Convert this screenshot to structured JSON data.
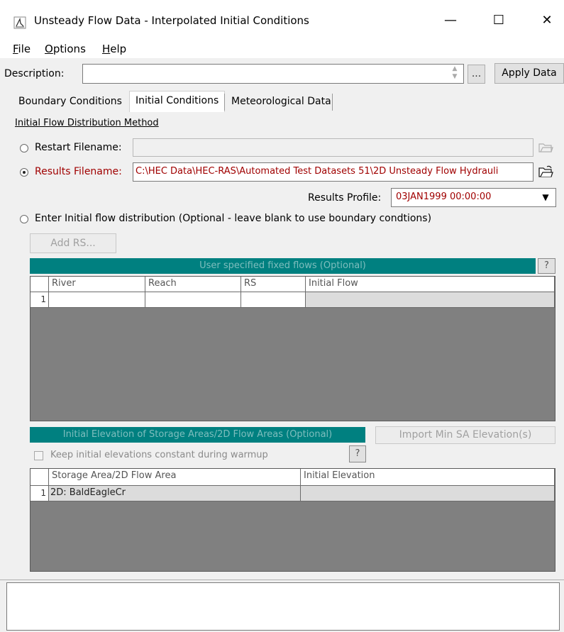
{
  "window": {
    "title": "Unsteady Flow Data - Interpolated Initial Conditions",
    "minimize": "—",
    "maximize": "☐",
    "close": "✕"
  },
  "menu": {
    "file": "File",
    "options": "Options",
    "help": "Help"
  },
  "description": {
    "label": "Description:",
    "value": "",
    "browse": "...",
    "apply": "Apply Data"
  },
  "tabs": [
    {
      "label": "Boundary Conditions",
      "active": false
    },
    {
      "label": "Initial Conditions",
      "active": true
    },
    {
      "label": "Meteorological Data",
      "active": false
    }
  ],
  "section_title": "Initial Flow Distribution Method",
  "restart": {
    "label": "Restart Filename:",
    "value": "",
    "selected": false
  },
  "results": {
    "label": "Results Filename:",
    "value": "C:\\HEC Data\\HEC-RAS\\Automated Test Datasets 51\\2D Unsteady Flow Hydrauli",
    "selected": true,
    "profile_label": "Results Profile:",
    "profile_value": "03JAN1999 00:00:00"
  },
  "enter_flow": {
    "label": "Enter Initial flow distribution (Optional - leave blank to use boundary condtions)",
    "selected": false,
    "add_rs": "Add RS..."
  },
  "fixed_flows": {
    "title": "User specified fixed flows (Optional)",
    "help": "?",
    "columns": [
      "River",
      "Reach",
      "RS",
      "Initial Flow"
    ],
    "rows": [
      {
        "num": "1",
        "river": "",
        "reach": "",
        "rs": "",
        "flow": ""
      }
    ]
  },
  "storage": {
    "title": "Initial Elevation of Storage Areas/2D Flow Areas (Optional)",
    "import_button": "Import Min SA Elevation(s)",
    "keep_constant": "Keep initial elevations constant during warmup",
    "help": "?",
    "columns": [
      "Storage Area/2D Flow Area",
      "Initial Elevation"
    ],
    "rows": [
      {
        "num": "1",
        "area": "2D: BaldEagleCr",
        "elev": ""
      }
    ]
  },
  "colors": {
    "accent_teal": "#008080",
    "results_red": "#a00000"
  }
}
